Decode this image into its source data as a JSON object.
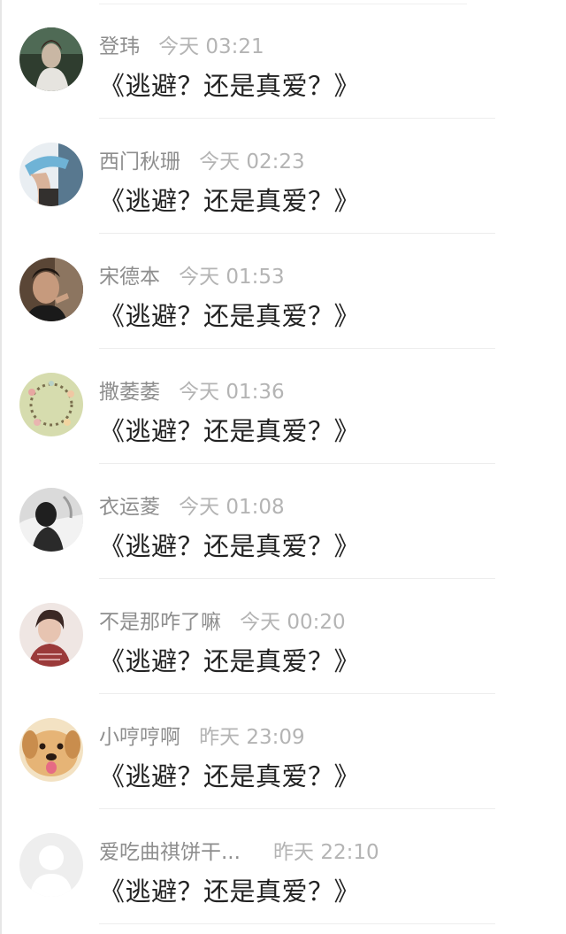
{
  "comments": [
    {
      "name": "登玮",
      "time": "今天 03:21",
      "text": "《逃避？还是真爱？》",
      "avatar": "avatar-icon",
      "avatar_bg": "#3b4b3a"
    },
    {
      "name": "西门秋珊",
      "time": "今天 02:23",
      "text": "《逃避？还是真爱？》",
      "avatar": "avatar-icon",
      "avatar_bg": "#7fa6bf"
    },
    {
      "name": "宋德本",
      "time": "今天 01:53",
      "text": "《逃避？还是真爱？》",
      "avatar": "avatar-icon",
      "avatar_bg": "#4a3a30"
    },
    {
      "name": "撒萎萎",
      "time": "今天 01:36",
      "text": "《逃避？还是真爱？》",
      "avatar": "avatar-icon",
      "avatar_bg": "#cfd9a6"
    },
    {
      "name": "衣运菱",
      "time": "今天 01:08",
      "text": "《逃避？还是真爱？》",
      "avatar": "avatar-icon",
      "avatar_bg": "#d8d8d8"
    },
    {
      "name": "不是那咋了嘛",
      "time": "今天 00:20",
      "text": "《逃避？还是真爱？》",
      "avatar": "avatar-icon",
      "avatar_bg": "#b89a8a"
    },
    {
      "name": "小哼哼啊",
      "time": "昨天 23:09",
      "text": "《逃避？还是真爱？》",
      "avatar": "avatar-icon",
      "avatar_bg": "#e3c089"
    },
    {
      "name": "爱吃曲祺饼干...",
      "time": "昨天 22:10",
      "text": "《逃避？还是真爱？》",
      "avatar": "default-avatar-icon",
      "avatar_bg": "#eeeeee"
    }
  ]
}
